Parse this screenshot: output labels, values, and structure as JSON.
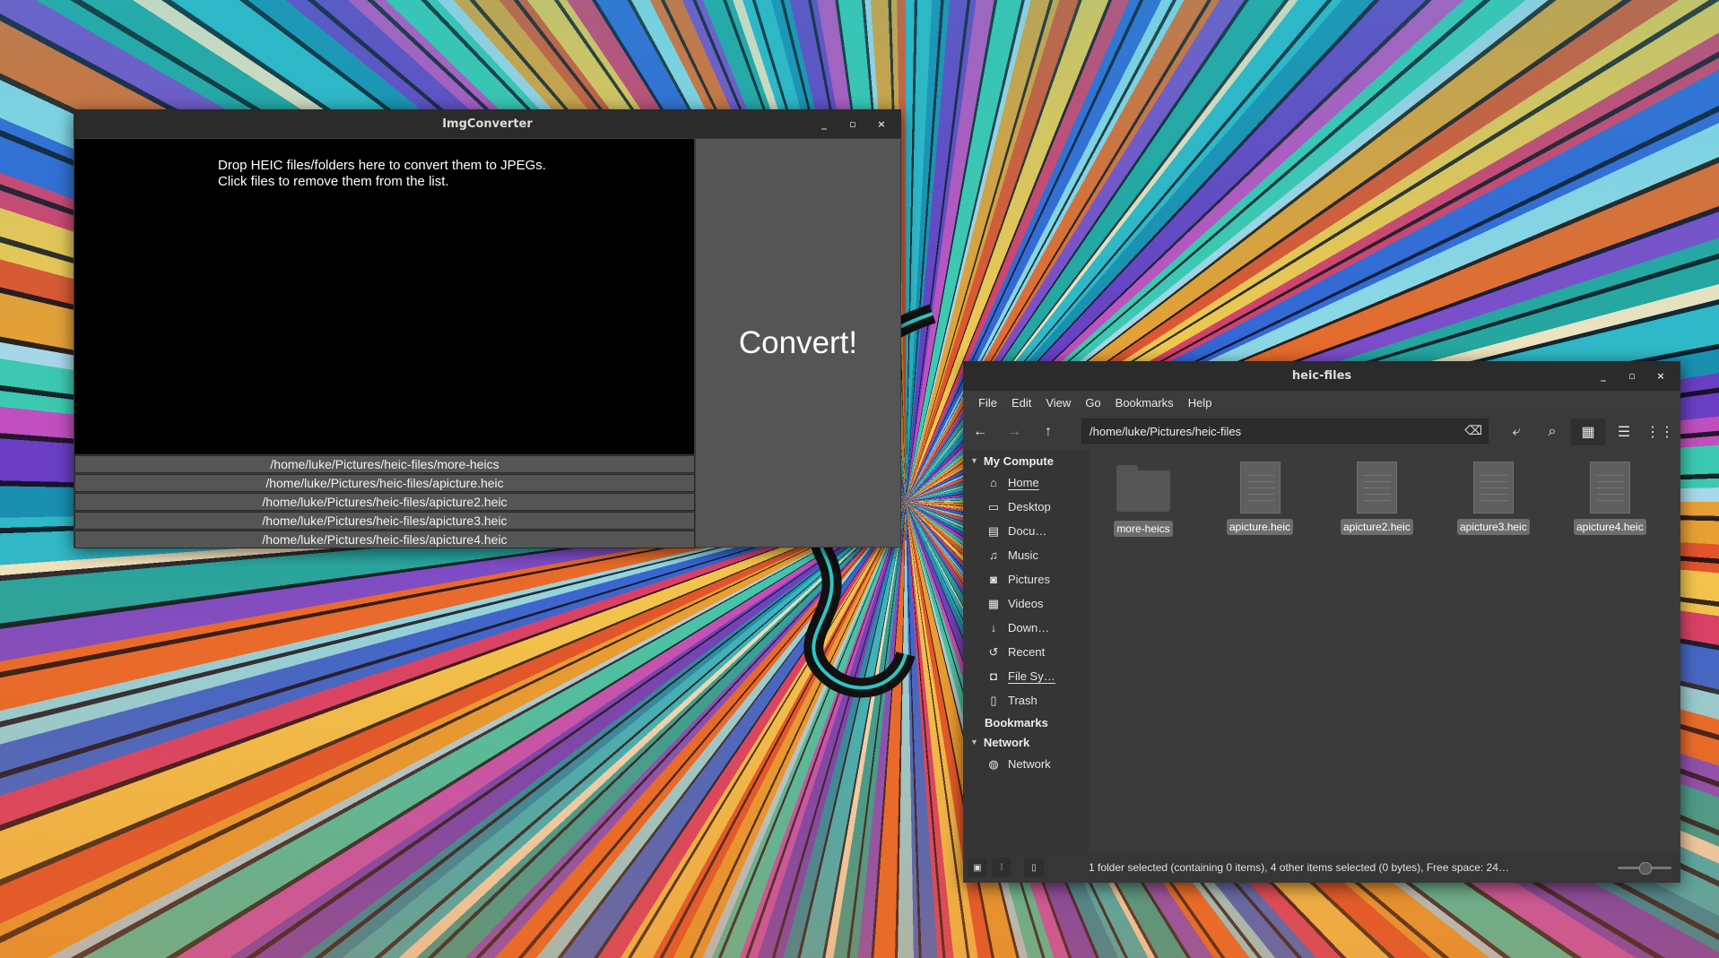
{
  "imgconverter": {
    "title": "ImgConverter",
    "controls": {
      "minimize": "_",
      "maximize": "▫",
      "close": "×"
    },
    "hint_line1": "Drop HEIC files/folders here to convert them to JPEGs.",
    "hint_line2": "Click files to remove them from the list.",
    "convert_label": "Convert!",
    "files": [
      "/home/luke/Pictures/heic-files/more-heics",
      "/home/luke/Pictures/heic-files/apicture.heic",
      "/home/luke/Pictures/heic-files/apicture2.heic",
      "/home/luke/Pictures/heic-files/apicture3.heic",
      "/home/luke/Pictures/heic-files/apicture4.heic"
    ]
  },
  "nemo": {
    "title": "heic-files",
    "controls": {
      "minimize": "_",
      "maximize": "▫",
      "close": "×"
    },
    "menu": [
      "File",
      "Edit",
      "View",
      "Go",
      "Bookmarks",
      "Help"
    ],
    "path": "/home/luke/Pictures/heic-files",
    "sidebar": {
      "my_computer": "My Compute",
      "items": [
        {
          "label": "Home",
          "icon": "home-icon",
          "glyph": "⌂"
        },
        {
          "label": "Desktop",
          "icon": "desktop-icon",
          "glyph": "▭"
        },
        {
          "label": "Docu…",
          "icon": "documents-icon",
          "glyph": "▤"
        },
        {
          "label": "Music",
          "icon": "music-icon",
          "glyph": "♫"
        },
        {
          "label": "Pictures",
          "icon": "camera-icon",
          "glyph": "◙"
        },
        {
          "label": "Videos",
          "icon": "film-icon",
          "glyph": "▦"
        },
        {
          "label": "Down…",
          "icon": "download-icon",
          "glyph": "↓"
        },
        {
          "label": "Recent",
          "icon": "recent-icon",
          "glyph": "↺"
        },
        {
          "label": "File Sy…",
          "icon": "drive-icon",
          "glyph": "◘"
        },
        {
          "label": "Trash",
          "icon": "trash-icon",
          "glyph": "▯"
        }
      ],
      "bookmarks": "Bookmarks",
      "network_header": "Network",
      "network_item": {
        "label": "Network",
        "icon": "network-icon",
        "glyph": "◍"
      }
    },
    "files": [
      {
        "name": "more-heics",
        "type": "folder"
      },
      {
        "name": "apicture.heic",
        "type": "file"
      },
      {
        "name": "apicture2.heic",
        "type": "file"
      },
      {
        "name": "apicture3.heic",
        "type": "file"
      },
      {
        "name": "apicture4.heic",
        "type": "file"
      }
    ],
    "status": "1 folder selected (containing 0 items), 4 other items selected (0 bytes), Free space: 24…"
  }
}
